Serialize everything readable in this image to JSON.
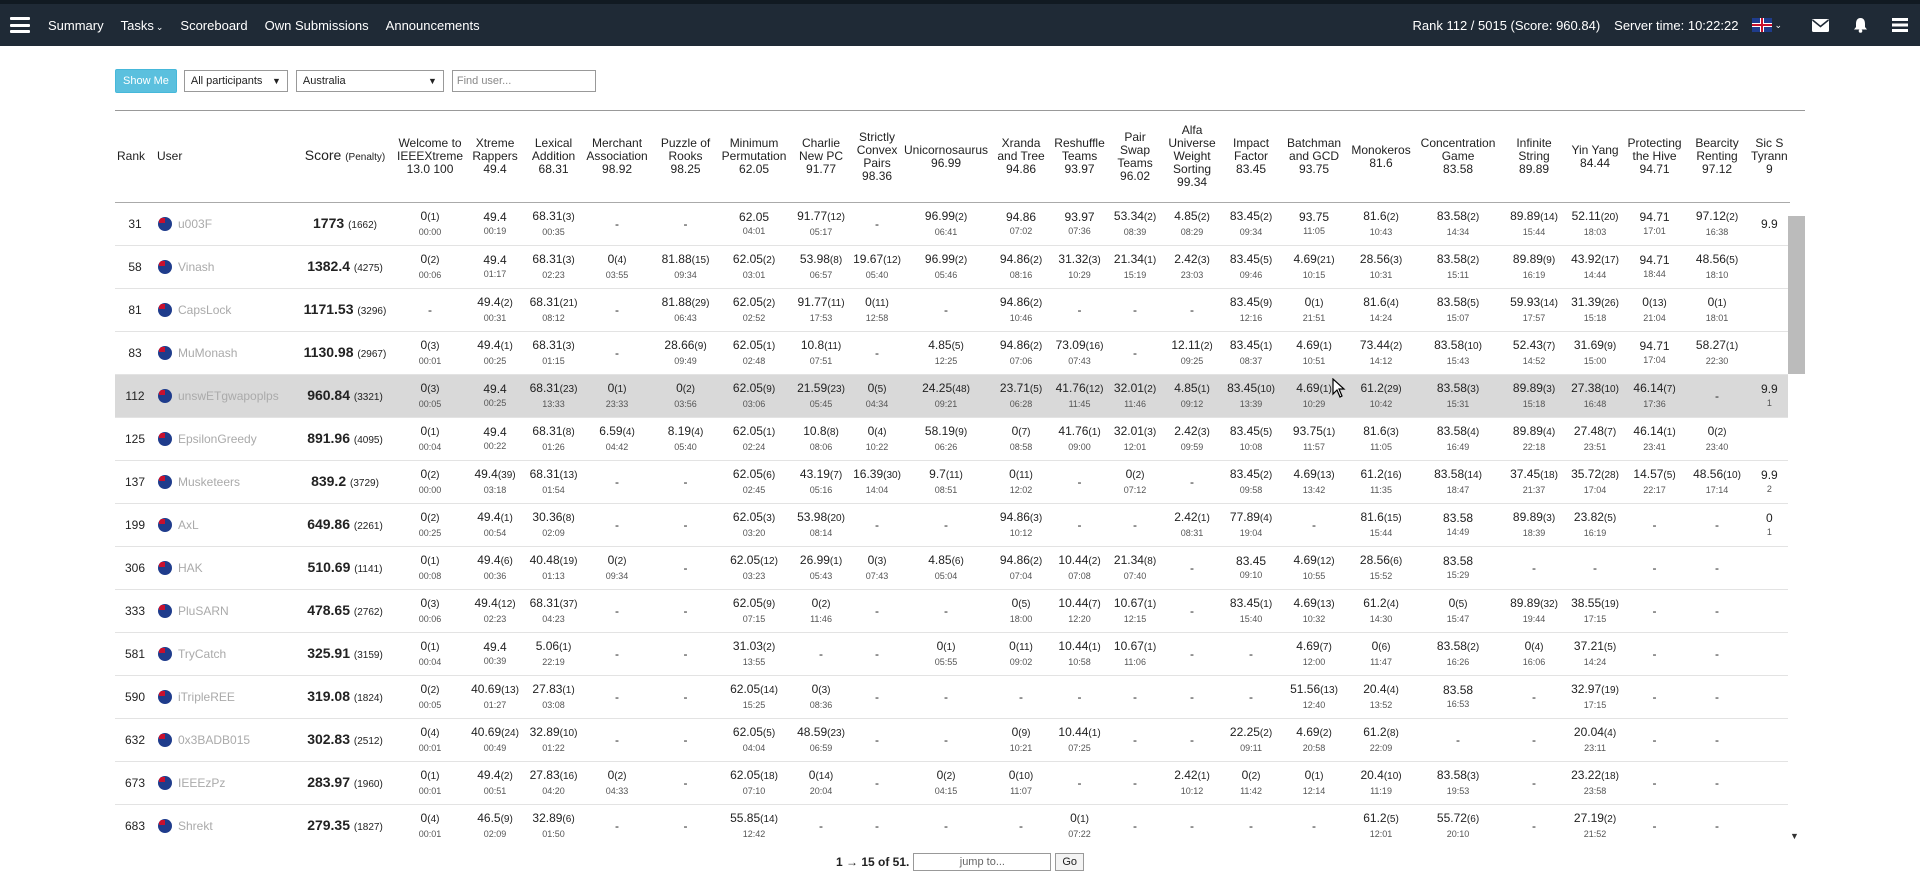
{
  "nav": {
    "items": [
      {
        "label": "Summary"
      },
      {
        "label": "Tasks",
        "caret": "⌄"
      },
      {
        "label": "Scoreboard"
      },
      {
        "label": "Own Submissions"
      },
      {
        "label": "Announcements"
      }
    ],
    "rank_info": "Rank 112 / 5015 (Score: 960.84)",
    "server_time": "Server time: 10:22:22",
    "icons": {
      "menu": "hamburger-icon",
      "mail": "envelope-icon",
      "bell": "bell-icon",
      "flag": "uk-flag-icon"
    }
  },
  "controls": {
    "show_me": "Show Me",
    "participants": "All participants",
    "country": "Australia",
    "find_placeholder": "Find user..."
  },
  "table": {
    "rank_header": "Rank",
    "user_header": "User",
    "score_header": "Score",
    "penalty_header": "(Penalty)",
    "tasks": [
      {
        "name": "Welcome to IEEEXtreme",
        "max": "13.0 100"
      },
      {
        "name": "Xtreme Rappers",
        "max": "49.4"
      },
      {
        "name": "Lexical Addition",
        "max": "68.31"
      },
      {
        "name": "Merchant Association",
        "max": "98.92"
      },
      {
        "name": "Puzzle of Rooks",
        "max": "98.25"
      },
      {
        "name": "Minimum Permutation",
        "max": "62.05"
      },
      {
        "name": "Charlie New PC",
        "max": "91.77"
      },
      {
        "name": "Strictly Convex Pairs",
        "max": "98.36"
      },
      {
        "name": "Unicornosaurus",
        "max": "96.99"
      },
      {
        "name": "Xranda and Tree",
        "max": "94.86"
      },
      {
        "name": "Reshuffle Teams",
        "max": "93.97"
      },
      {
        "name": "Pair Swap Teams",
        "max": "96.02"
      },
      {
        "name": "Alfa Universe Weight Sorting",
        "max": "99.34"
      },
      {
        "name": "Impact Factor",
        "max": "83.45"
      },
      {
        "name": "Batchman and GCD",
        "max": "93.75"
      },
      {
        "name": "Monokeros",
        "max": "81.6"
      },
      {
        "name": "Concentration Game",
        "max": "83.58"
      },
      {
        "name": "Infinite String",
        "max": "89.89"
      },
      {
        "name": "Yin Yang",
        "max": "84.44"
      },
      {
        "name": "Protecting the Hive",
        "max": "94.71"
      },
      {
        "name": "Bearcity Renting",
        "max": "97.12"
      },
      {
        "name": "Sic S Tyrann",
        "max": "9"
      }
    ],
    "rows": [
      {
        "rank": "31",
        "user": "u003F",
        "score": "1773",
        "penalty": "(1662)",
        "hl": false,
        "cells": [
          "0|1|00:00",
          "49.4||00:19",
          "68.31|3|00:35",
          "-",
          "-",
          "62.05||04:01",
          "91.77|12|05:17",
          "-",
          "96.99|2|06:41",
          "94.86||07:02",
          "93.97||07:36",
          "53.34|2|08:39",
          "4.85|2|08:29",
          "83.45|2|09:34",
          "93.75||11:05",
          "81.6|2|10:43",
          "83.58|2|14:34",
          "89.89|14|15:44",
          "52.11|20|18:03",
          "94.71||17:01",
          "97.12|2|16:38",
          "9.9||"
        ]
      },
      {
        "rank": "58",
        "user": "Vinash",
        "score": "1382.4",
        "penalty": "(4275)",
        "hl": false,
        "cells": [
          "0|2|00:06",
          "49.4||01:17",
          "68.31|3|02:23",
          "0|4|03:55",
          "81.88|15|09:34",
          "62.05|2|03:01",
          "53.98|8|06:57",
          "19.67|12|05:40",
          "96.99|2|05:46",
          "94.86|2|08:16",
          "31.32|3|10:29",
          "21.34|1|15:19",
          "2.42|3|23:03",
          "83.45|5|09:46",
          "4.69|21|10:15",
          "28.56|3|10:31",
          "83.58|2|15:11",
          "89.89|9|16:19",
          "43.92|17|14:44",
          "94.71||18:44",
          "48.56|5|18:10",
          ""
        ]
      },
      {
        "rank": "81",
        "user": "CapsLock",
        "score": "1171.53",
        "penalty": "(3296)",
        "hl": false,
        "cells": [
          "-",
          "49.4|2|00:31",
          "68.31|21|08:12",
          "-",
          "81.88|29|06:43",
          "62.05|2|02:52",
          "91.77|11|17:53",
          "0|11|12:58",
          "-",
          "94.86|2|10:46",
          "-",
          "-",
          "-",
          "83.45|9|12:16",
          "0|1|21:51",
          "81.6|4|14:24",
          "83.58|5|15:07",
          "59.93|14|17:57",
          "31.39|26|15:18",
          "0|13|21:04",
          "0|1|18:01",
          ""
        ]
      },
      {
        "rank": "83",
        "user": "MuMonash",
        "score": "1130.98",
        "penalty": "(2967)",
        "hl": false,
        "cells": [
          "0|3|00:01",
          "49.4|1|00:25",
          "68.31|3|01:15",
          "-",
          "28.66|9|09:49",
          "62.05|1|02:48",
          "10.8|11|07:51",
          "-",
          "4.85|5|12:25",
          "94.86|2|07:06",
          "73.09|16|07:43",
          "-",
          "12.11|2|09:25",
          "83.45|1|08:37",
          "4.69|1|10:51",
          "73.44|2|14:12",
          "83.58|10|15:43",
          "52.43|7|14:52",
          "31.69|9|15:00",
          "94.71||17:04",
          "58.27|1|22:30",
          ""
        ]
      },
      {
        "rank": "112",
        "user": "unswETgwapoplps",
        "score": "960.84",
        "penalty": "(3321)",
        "hl": true,
        "cells": [
          "0|3|00:05",
          "49.4||00:25",
          "68.31|23|13:33",
          "0|1|23:33",
          "0|2|03:56",
          "62.05|9|03:06",
          "21.59|23|05:45",
          "0|5|04:34",
          "24.25|48|09:21",
          "23.71|5|06:28",
          "41.76|12|11:45",
          "32.01|2|11:46",
          "4.85|1|09:12",
          "83.45|10|13:39",
          "4.69|1|10:29",
          "61.2|29|10:42",
          "83.58|3|15:31",
          "89.89|3|15:18",
          "27.38|10|16:48",
          "46.14|7|17:36",
          "-",
          "9.9||1"
        ]
      },
      {
        "rank": "125",
        "user": "EpsilonGreedy",
        "score": "891.96",
        "penalty": "(4095)",
        "hl": false,
        "cells": [
          "0|1|00:04",
          "49.4||00:22",
          "68.31|8|01:26",
          "6.59|4|04:42",
          "8.19|4|05:40",
          "62.05|1|02:24",
          "10.8|8|08:06",
          "0|4|10:22",
          "58.19|9|06:26",
          "0|7|08:58",
          "41.76|1|09:00",
          "32.01|3|12:01",
          "2.42|3|09:59",
          "83.45|5|10:08",
          "93.75|1|11:57",
          "81.6|3|11:05",
          "83.58|4|16:49",
          "89.89|4|22:18",
          "27.48|7|23:51",
          "46.14|1|23:41",
          "0|2|23:40",
          ""
        ]
      },
      {
        "rank": "137",
        "user": "Musketeers",
        "score": "839.2",
        "penalty": "(3729)",
        "hl": false,
        "cells": [
          "0|2|00:00",
          "49.4|39|03:18",
          "68.31|13|01:54",
          "-",
          "-",
          "62.05|6|02:45",
          "43.19|7|05:16",
          "16.39|30|14:04",
          "9.7|11|08:51",
          "0|11|12:02",
          "-",
          "0|2|07:12",
          "-",
          "83.45|2|09:58",
          "4.69|13|13:42",
          "61.2|16|11:35",
          "83.58|14|18:47",
          "37.45|18|21:37",
          "35.72|28|17:04",
          "14.57|5|22:17",
          "48.56|10|17:14",
          "9.9||2"
        ]
      },
      {
        "rank": "199",
        "user": "AxL",
        "score": "649.86",
        "penalty": "(2261)",
        "hl": false,
        "cells": [
          "0|2|00:25",
          "49.4|1|00:54",
          "30.36|8|02:09",
          "-",
          "-",
          "62.05|3|03:20",
          "53.98|20|08:14",
          "-",
          "-",
          "94.86|3|10:12",
          "-",
          "-",
          "2.42|1|08:31",
          "77.89|4|19:04",
          "-",
          "81.6|15|15:44",
          "83.58||14:49",
          "89.89|3|18:39",
          "23.82|5|16:19",
          "-",
          "-",
          "0||1"
        ]
      },
      {
        "rank": "306",
        "user": "HAK",
        "score": "510.69",
        "penalty": "(1141)",
        "hl": false,
        "cells": [
          "0|1|00:08",
          "49.4|6|00:36",
          "40.48|19|01:13",
          "0|2|09:34",
          "-",
          "62.05|12|03:23",
          "26.99|1|05:43",
          "0|3|07:43",
          "4.85|6|05:04",
          "94.86|2|07:04",
          "10.44|2|07:08",
          "21.34|8|07:40",
          "-",
          "83.45||09:10",
          "4.69|12|10:55",
          "28.56|6|15:52",
          "83.58||15:29",
          "-",
          "-",
          "-",
          "-",
          ""
        ]
      },
      {
        "rank": "333",
        "user": "PluSARN",
        "score": "478.65",
        "penalty": "(2762)",
        "hl": false,
        "cells": [
          "0|3|00:06",
          "49.4|12|02:23",
          "68.31|37|04:23",
          "-",
          "-",
          "62.05|9|07:15",
          "0|2|11:46",
          "-",
          "-",
          "0|5|18:00",
          "10.44|7|12:20",
          "10.67|1|12:15",
          "-",
          "83.45|1|15:40",
          "4.69|13|10:32",
          "61.2|4|14:30",
          "0|5|15:47",
          "89.89|32|19:44",
          "38.55|19|17:15",
          "-",
          "-",
          ""
        ]
      },
      {
        "rank": "581",
        "user": "TryCatch",
        "score": "325.91",
        "penalty": "(3159)",
        "hl": false,
        "cells": [
          "0|1|00:04",
          "49.4||00:39",
          "5.06|1|22:19",
          "-",
          "-",
          "31.03|2|13:55",
          "-",
          "-",
          "0|1|05:55",
          "0|11|09:02",
          "10.44|1|10:58",
          "10.67|1|11:06",
          "-",
          "-",
          "4.69|7|12:00",
          "0|6|11:47",
          "83.58|2|16:26",
          "0|4|16:06",
          "37.21|5|14:24",
          "-",
          "-",
          ""
        ]
      },
      {
        "rank": "590",
        "user": "iTripleREE",
        "score": "319.08",
        "penalty": "(1824)",
        "hl": false,
        "cells": [
          "0|2|00:05",
          "40.69|13|01:27",
          "27.83|1|03:08",
          "-",
          "-",
          "62.05|14|15:25",
          "0|3|08:36",
          "-",
          "-",
          "-",
          "-",
          "-",
          "-",
          "-",
          "51.56|13|12:40",
          "20.4|4|13:52",
          "83.58||16:53",
          "-",
          "32.97|19|17:15",
          "-",
          "-",
          ""
        ]
      },
      {
        "rank": "632",
        "user": "0x3BADB015",
        "score": "302.83",
        "penalty": "(2512)",
        "hl": false,
        "cells": [
          "0|4|00:01",
          "40.69|24|00:49",
          "32.89|10|01:22",
          "-",
          "-",
          "62.05|5|04:04",
          "48.59|23|06:59",
          "-",
          "-",
          "0|9|10:21",
          "10.44|1|07:25",
          "-",
          "-",
          "22.25|2|09:11",
          "4.69|2|20:58",
          "61.2|8|22:09",
          "-",
          "-",
          "20.04|4|23:11",
          "-",
          "-",
          ""
        ]
      },
      {
        "rank": "673",
        "user": "IEEEzPz",
        "score": "283.97",
        "penalty": "(1960)",
        "hl": false,
        "cells": [
          "0|1|00:01",
          "49.4|2|00:51",
          "27.83|16|04:20",
          "0|2|04:33",
          "-",
          "62.05|18|07:10",
          "0|14|20:04",
          "-",
          "0|2|04:15",
          "0|10|11:07",
          "-",
          "-",
          "2.42|1|10:12",
          "0|2|11:42",
          "0|1|12:14",
          "20.4|10|11:19",
          "83.58|3|19:53",
          "-",
          "23.22|18|23:58",
          "-",
          "-",
          ""
        ]
      },
      {
        "rank": "683",
        "user": "Shrekt",
        "score": "279.35",
        "penalty": "(1827)",
        "hl": false,
        "cells": [
          "0|4|00:01",
          "46.5|9|02:09",
          "32.89|6|01:50",
          "-",
          "-",
          "55.85|14|12:42",
          "-",
          "-",
          "-",
          "-",
          "0|1|07:22",
          "-",
          "-",
          "-",
          "-",
          "61.2|5|12:01",
          "55.72|6|20:10",
          "-",
          "27.19|2|21:52",
          "-",
          "-",
          ""
        ]
      }
    ]
  },
  "pager": {
    "text": "1 → 15 of 51.",
    "jump_placeholder": "jump to...",
    "go": "Go"
  }
}
